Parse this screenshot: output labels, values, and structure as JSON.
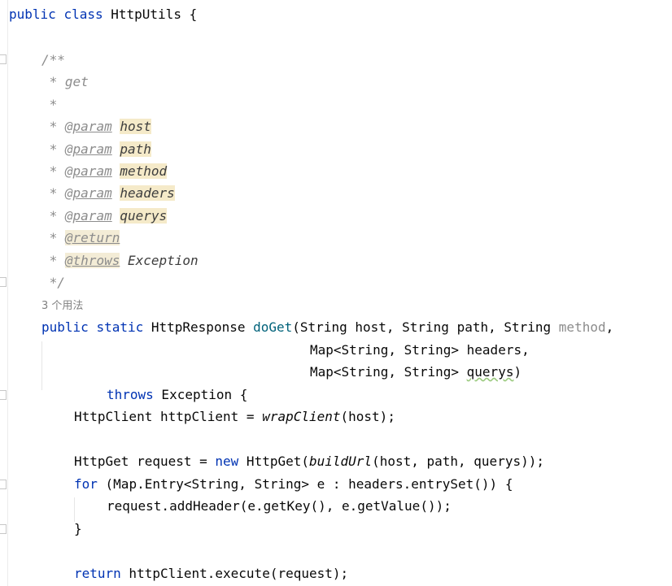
{
  "colors": {
    "keyword": "#0033b3",
    "method_decl": "#00627a",
    "comment": "#8c8c8c",
    "param_highlight": "#f5eac9",
    "text": "#080808"
  },
  "code": {
    "l1": {
      "kw1": "public",
      "kw2": "class",
      "name": "HttpUtils",
      "brace": "{"
    },
    "doc": {
      "open": "/**",
      "get": " * get",
      "blank": " *",
      "close": " */",
      "star": " * ",
      "param_tag": "@param",
      "params": [
        "host",
        "path",
        "method",
        "headers",
        "querys"
      ],
      "return_tag": "@return",
      "throws_tag": "@throws",
      "throws_value": "Exception"
    },
    "usages": "3 个用法",
    "sig": {
      "kw1": "public",
      "kw2": "static",
      "type": "HttpResponse ",
      "method": "doGet",
      "p1": "(String host, String path, String ",
      "p_unused": "method",
      "p1_end": ",",
      "p2": "Map<String, String> headers,",
      "p3a": "Map<String, String> ",
      "p3_warn": "querys",
      "p3b": ")",
      "throws_kw": "throws",
      "throws_rest": " Exception {"
    },
    "body": {
      "l1a": "HttpClient httpClient = ",
      "l1_call": "wrapClient",
      "l1b": "(host);",
      "l2a": "HttpGet request = ",
      "l2_new": "new",
      "l2b": " HttpGet(",
      "l2_call": "buildUrl",
      "l2c": "(host, path, querys));",
      "for_kw": "for",
      "for_rest": " (Map.Entry<String, String> e : headers.entrySet()) {",
      "add_header": "request.addHeader(e.getKey(), e.getValue());",
      "close_brace": "}",
      "return_kw": "return",
      "return_rest": " httpClient.execute(request);"
    }
  }
}
